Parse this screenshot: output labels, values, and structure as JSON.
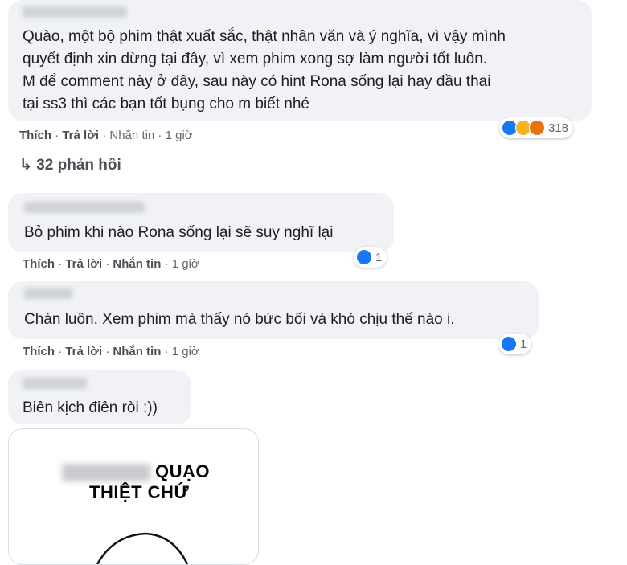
{
  "colors": {
    "like": "#1877f2",
    "haha": "#f7b125",
    "angry": "#e9710f",
    "bubble": "#f0f2f5"
  },
  "comments": [
    {
      "text_lines": [
        "Quào, một bộ phim thật xuất sắc, thật nhân văn và ý nghĩa, vì vậy mình",
        "quyết định xin dừng tại đây, vì xem phim xong sợ làm người tốt luôn.",
        "M để comment này ở đây, sau này có hint Rona sống lại hay đầu thai",
        "tại ss3 thì các bạn tốt bụng cho m biết nhé"
      ],
      "like": "Thích",
      "reply": "Trả lời",
      "message": "Nhắn tin",
      "time": "1 giờ",
      "reactions": [
        "like-icon",
        "haha-icon",
        "angry-icon"
      ],
      "reaction_count": "318",
      "replies": "↳ 32 phản hồi"
    },
    {
      "text_lines": [
        "Bỏ phim khi nào Rona sống lại sẽ suy nghĩ lại"
      ],
      "like": "Thích",
      "reply": "Trả lời",
      "message": "Nhắn tin",
      "time": "1 giờ",
      "reactions": [
        "like-icon"
      ],
      "reaction_count": "1"
    },
    {
      "text_lines": [
        "Chán luôn. Xem phim mà thấy nó bức bối và khó chịu thế nào i."
      ],
      "like": "Thích",
      "reply": "Trả lời",
      "message": "Nhắn tin",
      "time": "1 giờ",
      "reactions": [
        "like-icon"
      ],
      "reaction_count": "1"
    },
    {
      "text_lines": [
        "Biên kịch điên ròi :))"
      ]
    }
  ],
  "image_card": {
    "line1": "QUẠO",
    "line2": "THIỆT CHỨ"
  }
}
